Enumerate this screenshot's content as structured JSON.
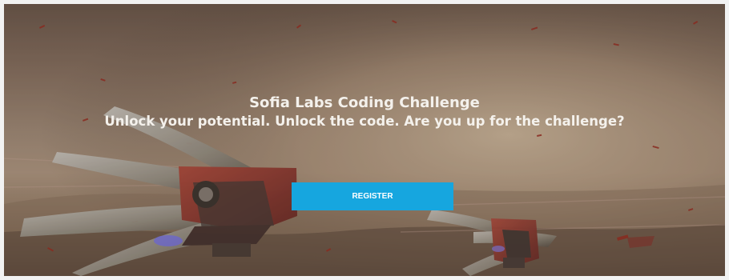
{
  "hero": {
    "title": "Sofia Labs Coding Challenge",
    "subtitle": "Unlock your potential. Unlock the code. Are you up for the challenge?",
    "button_label": "REGISTER",
    "accent_color": "#16a6df",
    "background_icon": "flying-craft-illustration-icon"
  }
}
